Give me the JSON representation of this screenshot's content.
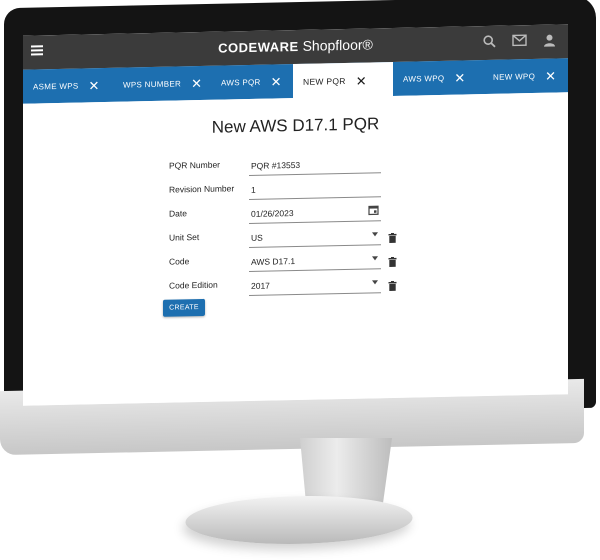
{
  "app": {
    "brand_main": "CODEWARE",
    "brand_sub": "Shopfloor®"
  },
  "tabs": [
    {
      "label": "ASME WPS",
      "active": false
    },
    {
      "label": "WPS NUMBER",
      "active": false
    },
    {
      "label": "AWS PQR",
      "active": false
    },
    {
      "label": "NEW PQR",
      "active": true
    },
    {
      "label": "AWS WPQ",
      "active": false
    },
    {
      "label": "NEW WPQ",
      "active": false
    }
  ],
  "form": {
    "title": "New AWS D17.1 PQR",
    "fields": {
      "pqr_number": {
        "label": "PQR Number",
        "value": "PQR #13553"
      },
      "revision_number": {
        "label": "Revision Number",
        "value": "1"
      },
      "date": {
        "label": "Date",
        "value": "01/26/2023"
      },
      "unit_set": {
        "label": "Unit Set",
        "value": "US"
      },
      "code": {
        "label": "Code",
        "value": "AWS D17.1"
      },
      "code_edition": {
        "label": "Code Edition",
        "value": "2017"
      }
    },
    "create_label": "CREATE"
  },
  "icons": {
    "menu": "hamburger-menu-icon",
    "search": "search-icon",
    "mail": "mail-icon",
    "user": "user-icon",
    "close": "close-icon",
    "calendar": "calendar-icon",
    "dropdown": "dropdown-arrow-icon",
    "trash": "trash-icon"
  },
  "colors": {
    "appbar": "#3b3b3b",
    "tabbar": "#1d6fb0",
    "primary_button": "#1d6fb0"
  }
}
